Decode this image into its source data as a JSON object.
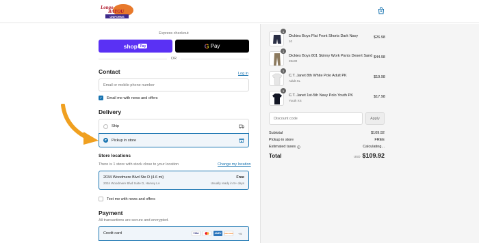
{
  "header": {
    "logo_text_top": "Longo",
    "logo_text_mid": "BAYOU",
    "logo_text_bottom": "UNIFORMS"
  },
  "express": {
    "label": "Express checkout",
    "shop_pay_label": "shop",
    "shop_pay_badge": "Pay",
    "gpay_g": "G",
    "gpay_label": "Pay",
    "or_label": "OR"
  },
  "contact": {
    "title": "Contact",
    "login_label": "Log in",
    "input_placeholder": "Email or mobile phone number",
    "newsletter_label": "Email me with news and offers",
    "newsletter_checked": true
  },
  "delivery": {
    "title": "Delivery",
    "options": [
      {
        "label": "Ship",
        "selected": false,
        "icon": "truck-icon"
      },
      {
        "label": "Pickup in store",
        "selected": true,
        "icon": "store-icon"
      }
    ]
  },
  "store_locations": {
    "title": "Store locations",
    "summary": "There is 1 store with stock close to your location",
    "change_label": "Change my location",
    "store": {
      "name": "2034 Woodmere Blvd Ste D (4.6 mi)",
      "address": "2034 Woodmere Blvd Suite D, Harvey LA",
      "price": "Free",
      "ready": "Usually ready in 5+ days"
    },
    "text_me_label": "Text me with news and offers"
  },
  "payment": {
    "title": "Payment",
    "subtitle": "All transactions are secure and encrypted.",
    "method_label": "Credit card",
    "card_brands": [
      "VISA",
      "MC",
      "AMEX",
      "DISCOVER"
    ],
    "more_label": "+4"
  },
  "order": {
    "items": [
      {
        "qty": "1",
        "title": "Dickies Boys Flat Front Shorts Dark Navy",
        "variant": "10",
        "price": "$26.98",
        "thumb": "navy-shorts"
      },
      {
        "qty": "1",
        "title": "Dickies Boys 801 Skinny Work Pants Desert Sand",
        "variant": "28x30",
        "price": "$44.98",
        "thumb": "khaki-pants"
      },
      {
        "qty": "1",
        "title": "C.T. Janet 8th White Polo Adult PK",
        "variant": "Adult XL",
        "price": "$19.98",
        "thumb": "white-polo"
      },
      {
        "qty": "1",
        "title": "C.T. Janet 1st-5th Navy Polo Youth PK",
        "variant": "Youth XS",
        "price": "$17.98",
        "thumb": "navy-polo"
      }
    ],
    "discount_placeholder": "Discount code",
    "apply_label": "Apply",
    "subtotal_label": "Subtotal",
    "subtotal_value": "$109.92",
    "pickup_label": "Pickup in store",
    "pickup_value": "FREE",
    "taxes_label": "Estimated taxes",
    "taxes_value": "Calculating...",
    "total_label": "Total",
    "currency": "USD",
    "total_value": "$109.92"
  },
  "colors": {
    "accent": "#1773b0",
    "shop_pay": "#5a31f4",
    "arrow": "#f0a020"
  }
}
